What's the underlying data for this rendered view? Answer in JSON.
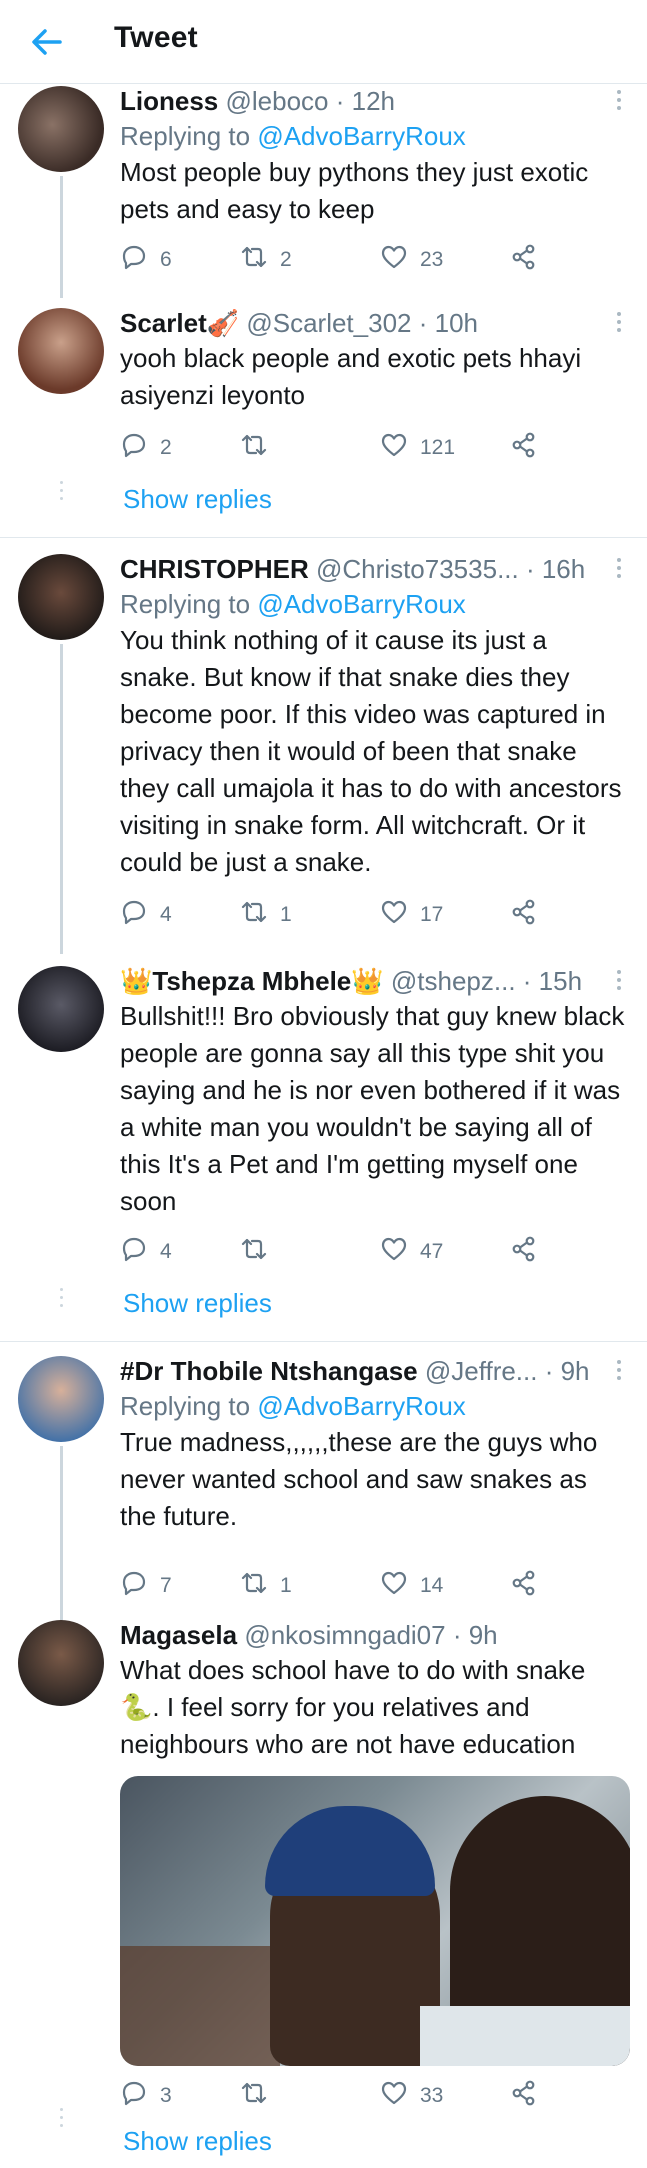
{
  "header": {
    "title": "Tweet",
    "back_icon": "arrow-left-icon"
  },
  "tweets": [
    {
      "name": "Lioness",
      "handle": "@leboco",
      "time": "· 12h",
      "replying_label": "Replying to",
      "replying_handle": "@AdvoBarryRoux",
      "text": "Most people buy pythons they just exotic pets and  easy to keep",
      "replies": "6",
      "retweets": "2",
      "likes": "23",
      "avatar_color": "#4b3b33"
    },
    {
      "name": "Scarlet🎻",
      "handle": "@Scarlet_302",
      "time": "· 10h",
      "text": "yooh black people and exotic pets hhayi asiyenzi leyonto",
      "replies": "2",
      "retweets": "",
      "likes": "121",
      "avatar_color": "#8a5a3c"
    },
    {
      "name": "CHRISTOPHER",
      "handle": "@Christo73535...",
      "time": "· 16h",
      "replying_label": "Replying to",
      "replying_handle": "@AdvoBarryRoux",
      "text": "You think nothing of it cause its just a snake. But know if that snake dies they become poor. If this video was captured in privacy then it would of been that snake they call umajola it has to do with ancestors visiting in snake form. All witchcraft. Or it could be just a snake.",
      "replies": "4",
      "retweets": "1",
      "likes": "17",
      "avatar_color": "#3a2a24"
    },
    {
      "name": "👑Tshepza Mbhele👑",
      "handle": "@tshepz...",
      "time": "· 15h",
      "text": "Bullshit!!! Bro obviously that guy knew black people are gonna say all this type shit you saying and he is nor even bothered if it was a white man you wouldn't be saying all of this It's a Pet and I'm getting myself one soon",
      "replies": "4",
      "retweets": "",
      "likes": "47",
      "avatar_color": "#2e2e33"
    },
    {
      "name": "#Dr Thobile Ntshangase",
      "handle": "@Jeffre...",
      "time": "· 9h",
      "replying_label": "Replying to",
      "replying_handle": "@AdvoBarryRoux",
      "text": "True madness,,,,,,these are the guys who never wanted school and saw snakes as the future.",
      "replies": "7",
      "retweets": "1",
      "likes": "14",
      "avatar_color": "#6b4a3a"
    },
    {
      "name": "Magasela",
      "handle": "@nkosimngadi07",
      "time": "· 9h",
      "text": "What does school have to do with snake 🐍. I feel sorry for you relatives and neighbours who are not have education",
      "replies": "3",
      "retweets": "",
      "likes": "33",
      "avatar_color": "#4a3a30"
    }
  ],
  "show_replies_label": "Show replies",
  "colors": {
    "accent": "#1da1f2",
    "muted": "#657786",
    "divider": "#e1e8ed"
  }
}
